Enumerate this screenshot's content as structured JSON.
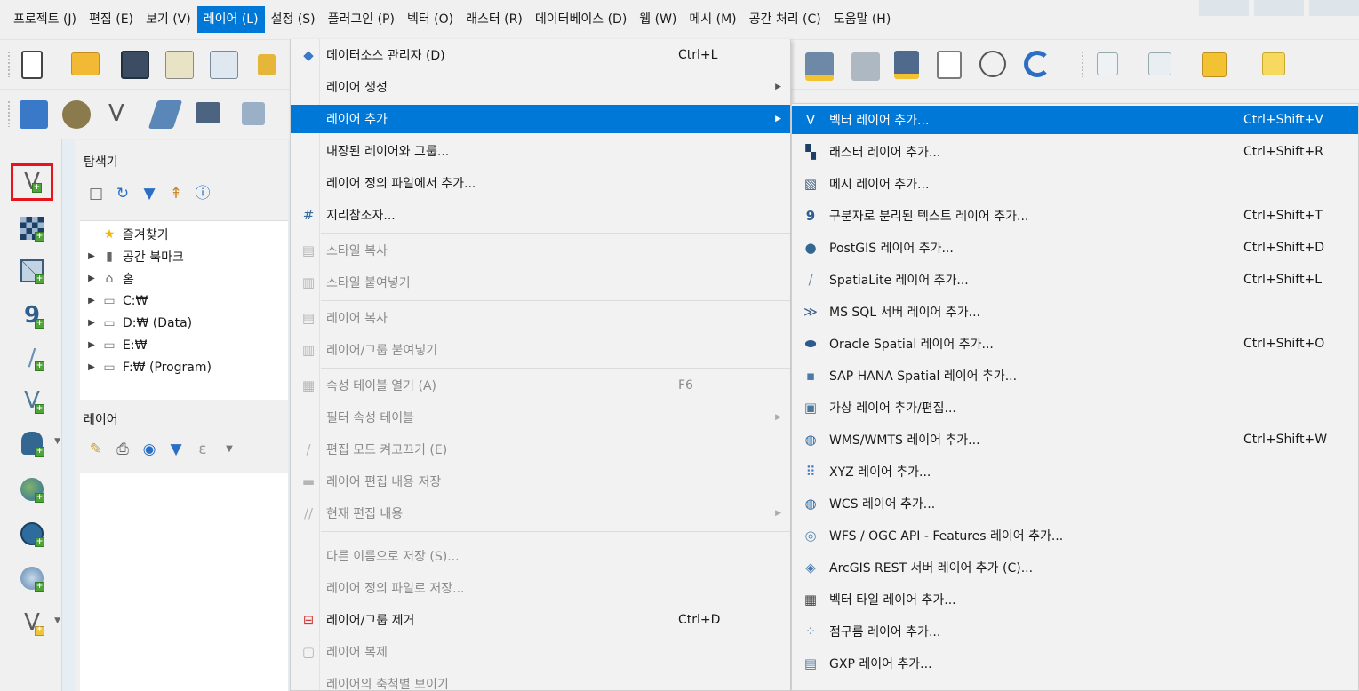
{
  "menubar": {
    "items": [
      "프로젝트 (J)",
      "편집 (E)",
      "보기 (V)",
      "레이어 (L)",
      "설정 (S)",
      "플러그인 (P)",
      "벡터 (O)",
      "래스터 (R)",
      "데이터베이스 (D)",
      "웹 (W)",
      "메시 (M)",
      "공간 처리 (C)",
      "도움말 (H)"
    ],
    "active_index": 3
  },
  "browser": {
    "title": "탐색기",
    "tree": [
      {
        "label": "즐겨찾기",
        "icon": "star-icon",
        "expandable": false
      },
      {
        "label": "공간 북마크",
        "icon": "bookmark-icon",
        "expandable": true
      },
      {
        "label": "홈",
        "icon": "home-folder-icon",
        "expandable": true
      },
      {
        "label": "C:₩",
        "icon": "folder-icon",
        "expandable": true
      },
      {
        "label": "D:₩ (Data)",
        "icon": "folder-icon",
        "expandable": true
      },
      {
        "label": "E:₩",
        "icon": "folder-icon",
        "expandable": true
      },
      {
        "label": "F:₩ (Program)",
        "icon": "folder-icon",
        "expandable": true
      }
    ]
  },
  "layers": {
    "title": "레이어"
  },
  "layer_menu": {
    "items": [
      {
        "label": "데이터소스 관리자 (D)",
        "shortcut": "Ctrl+L",
        "icon": "datasource-manager-icon",
        "submenu": false,
        "disabled": false
      },
      {
        "label": "레이어 생성",
        "shortcut": "",
        "icon": "",
        "submenu": true,
        "disabled": false
      },
      {
        "label": "레이어 추가",
        "shortcut": "",
        "icon": "",
        "submenu": true,
        "disabled": false,
        "highlighted": true
      },
      {
        "label": "내장된 레이어와 그룹...",
        "shortcut": "",
        "icon": "",
        "submenu": false,
        "disabled": false
      },
      {
        "label": "레이어 정의 파일에서 추가...",
        "shortcut": "",
        "icon": "",
        "submenu": false,
        "disabled": false
      },
      {
        "label": "지리참조자...",
        "shortcut": "",
        "icon": "georeferencer-icon",
        "submenu": false,
        "disabled": false
      },
      {
        "label": "스타일 복사",
        "shortcut": "",
        "icon": "copy-style-icon",
        "submenu": false,
        "disabled": true
      },
      {
        "label": "스타일 붙여넣기",
        "shortcut": "",
        "icon": "paste-style-icon",
        "submenu": false,
        "disabled": true
      },
      {
        "label": "레이어 복사",
        "shortcut": "",
        "icon": "copy-layer-icon",
        "submenu": false,
        "disabled": true
      },
      {
        "label": "레이어/그룹 붙여넣기",
        "shortcut": "",
        "icon": "paste-layer-icon",
        "submenu": false,
        "disabled": true
      },
      {
        "label": "속성 테이블 열기 (A)",
        "shortcut": "F6",
        "icon": "attribute-table-icon",
        "submenu": false,
        "disabled": true
      },
      {
        "label": "필터 속성 테이블",
        "shortcut": "",
        "icon": "",
        "submenu": true,
        "disabled": true
      },
      {
        "label": "편집 모드 켜고끄기 (E)",
        "shortcut": "",
        "icon": "pencil-icon",
        "submenu": false,
        "disabled": true
      },
      {
        "label": "레이어 편집 내용 저장",
        "shortcut": "",
        "icon": "save-edits-icon",
        "submenu": false,
        "disabled": true
      },
      {
        "label": "현재 편집 내용",
        "shortcut": "",
        "icon": "current-edits-icon",
        "submenu": true,
        "disabled": true
      },
      {
        "label": "다른 이름으로 저장 (S)...",
        "shortcut": "",
        "icon": "",
        "submenu": false,
        "disabled": true
      },
      {
        "label": "레이어 정의 파일로 저장...",
        "shortcut": "",
        "icon": "",
        "submenu": false,
        "disabled": true
      },
      {
        "label": "레이어/그룹 제거",
        "shortcut": "Ctrl+D",
        "icon": "remove-layer-icon",
        "submenu": false,
        "disabled": false
      },
      {
        "label": "레이어 복제",
        "shortcut": "",
        "icon": "duplicate-layer-icon",
        "submenu": false,
        "disabled": true
      },
      {
        "label": "레이어의 축척별 보이기",
        "shortcut": "",
        "icon": "",
        "submenu": false,
        "disabled": true
      }
    ]
  },
  "add_layer_submenu": {
    "items": [
      {
        "label": "벡터 레이어 추가...",
        "shortcut": "Ctrl+Shift+V",
        "icon": "vector-layer-icon",
        "highlighted": true
      },
      {
        "label": "래스터 레이어 추가...",
        "shortcut": "Ctrl+Shift+R",
        "icon": "raster-layer-icon"
      },
      {
        "label": "메시 레이어 추가...",
        "shortcut": "",
        "icon": "mesh-layer-icon"
      },
      {
        "label": "구분자로 분리된 텍스트 레이어 추가...",
        "shortcut": "Ctrl+Shift+T",
        "icon": "delimited-text-icon"
      },
      {
        "label": "PostGIS 레이어 추가...",
        "shortcut": "Ctrl+Shift+D",
        "icon": "postgis-icon"
      },
      {
        "label": "SpatiaLite 레이어 추가...",
        "shortcut": "Ctrl+Shift+L",
        "icon": "spatialite-icon"
      },
      {
        "label": "MS SQL 서버 레이어 추가...",
        "shortcut": "",
        "icon": "mssql-icon"
      },
      {
        "label": "Oracle Spatial 레이어 추가...",
        "shortcut": "Ctrl+Shift+O",
        "icon": "oracle-icon"
      },
      {
        "label": "SAP HANA Spatial 레이어 추가...",
        "shortcut": "",
        "icon": "hana-icon"
      },
      {
        "label": "가상 레이어 추가/편집...",
        "shortcut": "",
        "icon": "virtual-layer-icon"
      },
      {
        "label": "WMS/WMTS 레이어 추가...",
        "shortcut": "Ctrl+Shift+W",
        "icon": "wms-icon"
      },
      {
        "label": "XYZ 레이어 추가...",
        "shortcut": "",
        "icon": "xyz-icon"
      },
      {
        "label": "WCS 레이어 추가...",
        "shortcut": "",
        "icon": "wcs-icon"
      },
      {
        "label": "WFS / OGC API - Features 레이어 추가...",
        "shortcut": "",
        "icon": "wfs-icon"
      },
      {
        "label": "ArcGIS REST 서버 레이어 추가 (C)...",
        "shortcut": "",
        "icon": "arcgis-icon"
      },
      {
        "label": "벡터 타일 레이어 추가...",
        "shortcut": "",
        "icon": "vector-tile-icon"
      },
      {
        "label": "점구름 레이어 추가...",
        "shortcut": "",
        "icon": "point-cloud-icon"
      },
      {
        "label": "GXP 레이어 추가...",
        "shortcut": "",
        "icon": "gxp-icon"
      }
    ]
  },
  "colors": {
    "highlight": "#0078d7",
    "annotation_box": "#e8141b"
  }
}
